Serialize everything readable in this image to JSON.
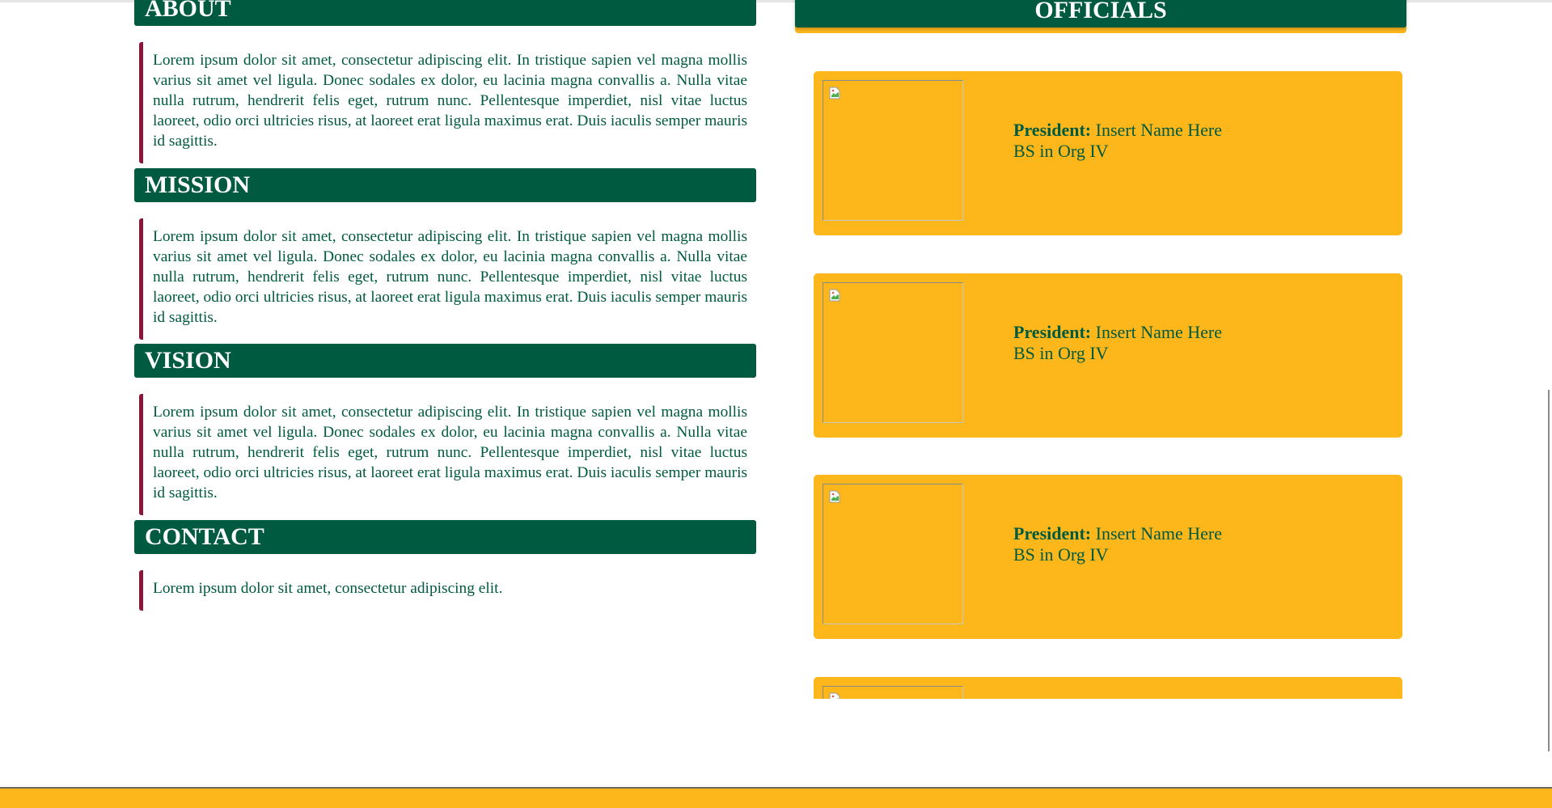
{
  "sections": [
    {
      "heading": "ABOUT",
      "body": "Lorem ipsum dolor sit amet, consectetur adipiscing elit. In tristique sapien vel magna mollis varius sit amet vel ligula. Donec sodales ex dolor, eu lacinia magna convallis a. Nulla vitae nulla rutrum, hendrerit felis eget, rutrum nunc. Pellentesque imperdiet, nisl vitae luctus laoreet, odio orci ultricies risus, at laoreet erat ligula maximus erat. Duis iaculis semper mauris id sagittis."
    },
    {
      "heading": "MISSION",
      "body": "Lorem ipsum dolor sit amet, consectetur adipiscing elit. In tristique sapien vel magna mollis varius sit amet vel ligula. Donec sodales ex dolor, eu lacinia magna convallis a. Nulla vitae nulla rutrum, hendrerit felis eget, rutrum nunc. Pellentesque imperdiet, nisl vitae luctus laoreet, odio orci ultricies risus, at laoreet erat ligula maximus erat. Duis iaculis semper mauris id sagittis."
    },
    {
      "heading": "VISION",
      "body": "Lorem ipsum dolor sit amet, consectetur adipiscing elit. In tristique sapien vel magna mollis varius sit amet vel ligula. Donec sodales ex dolor, eu lacinia magna convallis a. Nulla vitae nulla rutrum, hendrerit felis eget, rutrum nunc. Pellentesque imperdiet, nisl vitae luctus laoreet, odio orci ultricies risus, at laoreet erat ligula maximus erat. Duis iaculis semper mauris id sagittis."
    },
    {
      "heading": "CONTACT",
      "body": "Lorem ipsum dolor sit amet, consectetur adipiscing elit."
    }
  ],
  "officials": {
    "heading": "OFFICIALS",
    "cards": [
      {
        "role": "President:",
        "name": "Insert Name Here",
        "program": "BS in Org IV",
        "photo_icon": "broken-image-icon"
      },
      {
        "role": "President:",
        "name": "Insert Name Here",
        "program": "BS in Org IV",
        "photo_icon": "broken-image-icon"
      },
      {
        "role": "President:",
        "name": "Insert Name Here",
        "program": "BS in Org IV",
        "photo_icon": "broken-image-icon"
      },
      {
        "role": "",
        "name": "",
        "program": "",
        "photo_icon": "broken-image-icon"
      }
    ]
  },
  "colors": {
    "primary_green": "#005a3f",
    "accent_gold": "#fdb71a",
    "accent_maroon": "#8a1538",
    "background": "#ffffff"
  }
}
